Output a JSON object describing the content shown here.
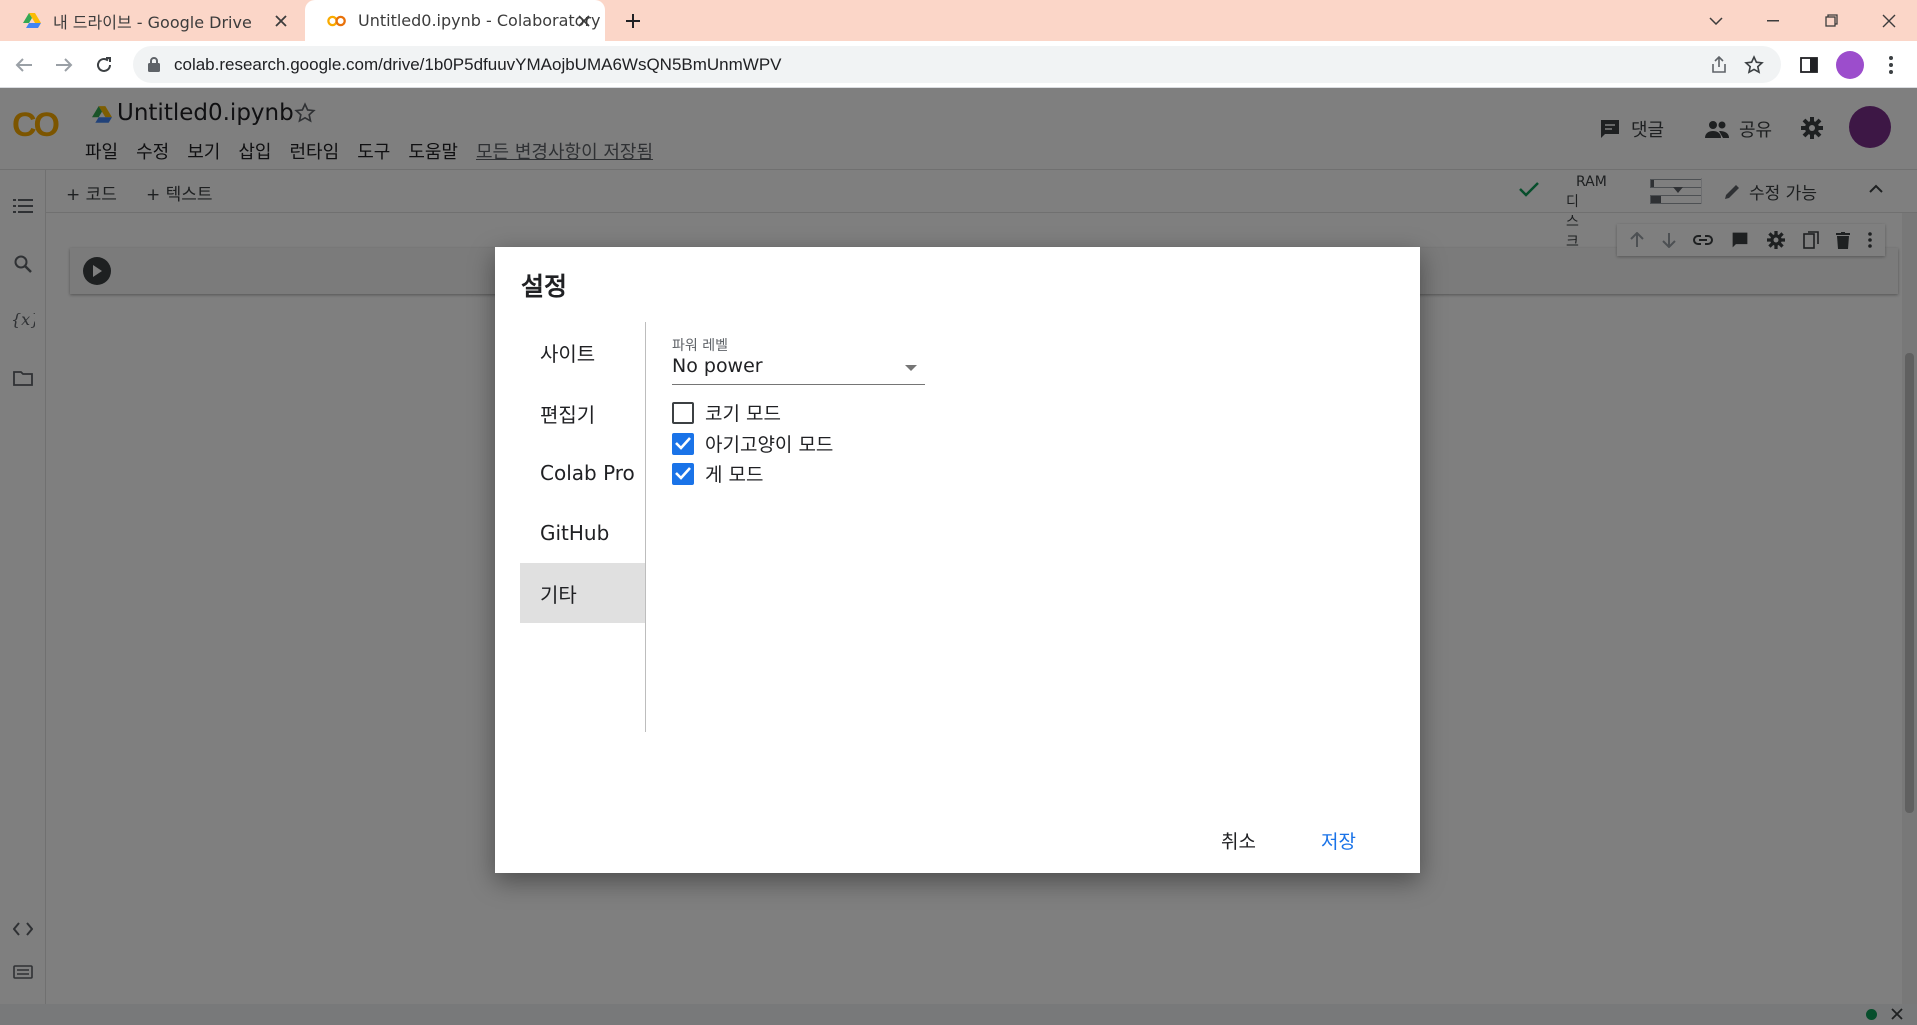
{
  "browser": {
    "tabs": [
      {
        "title": "내 드라이브 - Google Drive",
        "favicon": "google-drive-icon"
      },
      {
        "title": "Untitled0.ipynb - Colaboratory",
        "favicon": "colab-icon"
      }
    ],
    "url": "colab.research.google.com/drive/1b0P5dfuuvYMAojbUMA6WsQN5BmUnmWPV"
  },
  "colab": {
    "logo": "CO",
    "notebook_title": "Untitled0.ipynb",
    "menu": [
      "파일",
      "수정",
      "보기",
      "삽입",
      "런타임",
      "도구",
      "도움말"
    ],
    "save_status": "모든 변경사항이 저장됨",
    "comments_label": "댓글",
    "share_label": "공유",
    "toolbar": {
      "add_code": "+ 코드",
      "add_text": "+ 텍스트",
      "ram_label": "RAM",
      "disk_label": "디스크",
      "ram_usage": 0.05,
      "disk_usage": 0.2,
      "edit_label": "수정 가능"
    },
    "colors": {
      "accent": "#1a73e8",
      "tabstrip": "#fbd6c8",
      "logo": "#f9ab00"
    }
  },
  "dialog": {
    "title": "설정",
    "nav": [
      "사이트",
      "편집기",
      "Colab Pro",
      "GitHub",
      "기타"
    ],
    "active_nav": "기타",
    "power_label": "파워 레벨",
    "power_value": "No power",
    "options": [
      {
        "label": "코기 모드",
        "checked": false
      },
      {
        "label": "아기고양이 모드",
        "checked": true
      },
      {
        "label": "게 모드",
        "checked": true
      }
    ],
    "cancel": "취소",
    "save": "저장"
  }
}
